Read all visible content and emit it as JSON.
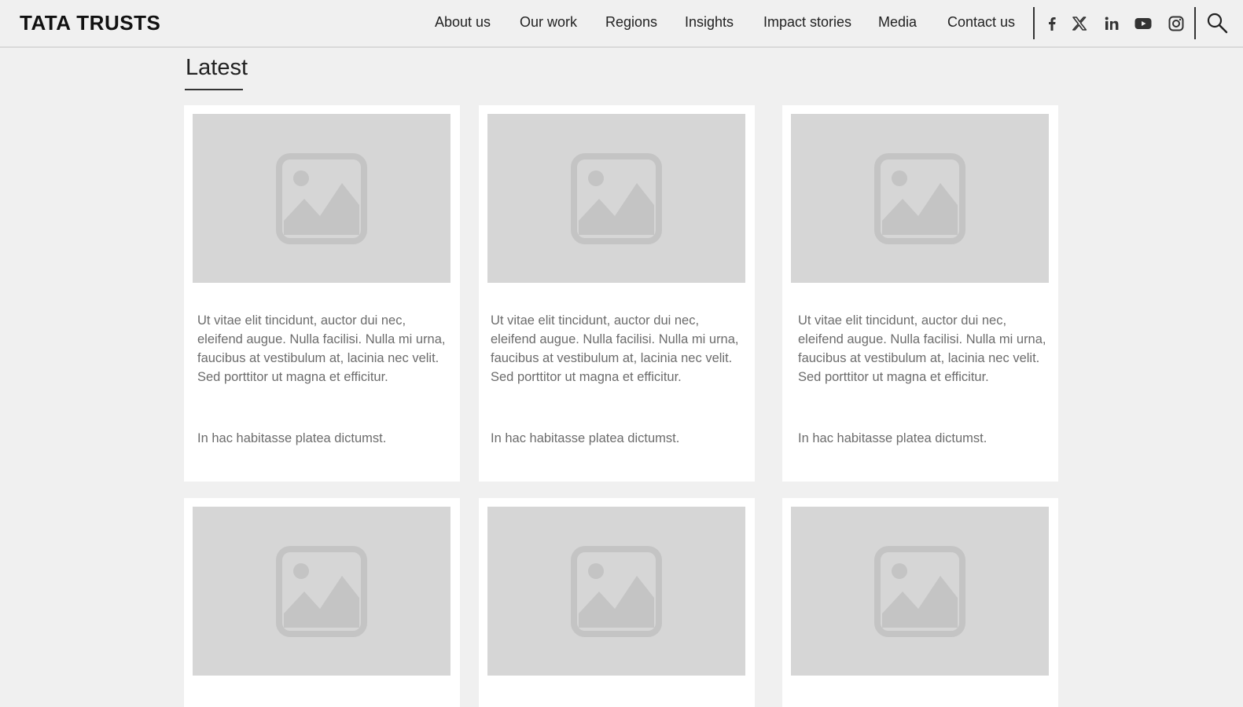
{
  "header": {
    "logo": "TATA TRUSTS",
    "nav": [
      "About us",
      "Our work",
      "Regions",
      "Insights",
      "Impact stories",
      "Media",
      "Contact us"
    ],
    "social_icons": [
      "facebook-icon",
      "x-twitter-icon",
      "linkedin-icon",
      "youtube-icon",
      "instagram-icon"
    ],
    "search_icon": "search-icon"
  },
  "main": {
    "section_title": "Latest",
    "cards": [
      {
        "image": "image-placeholder-icon",
        "description": "Ut vitae elit tincidunt, auctor dui nec, eleifend augue. Nulla facilisi. Nulla mi urna, faucibus at vestibulum at, lacinia nec velit. Sed porttitor ut magna et efficitur.",
        "meta": "In hac habitasse platea dictumst."
      },
      {
        "image": "image-placeholder-icon",
        "description": "Ut vitae elit tincidunt, auctor dui nec, eleifend augue. Nulla facilisi. Nulla mi urna, faucibus at vestibulum at, lacinia nec velit. Sed porttitor ut magna et efficitur.",
        "meta": "In hac habitasse platea dictumst."
      },
      {
        "image": "image-placeholder-icon",
        "description": "Ut vitae elit tincidunt, auctor dui nec, eleifend augue. Nulla facilisi. Nulla mi urna, faucibus at vestibulum at, lacinia nec velit. Sed porttitor ut magna et efficitur.",
        "meta": "In hac habitasse platea dictumst."
      },
      {
        "image": "image-placeholder-icon"
      },
      {
        "image": "image-placeholder-icon"
      },
      {
        "image": "image-placeholder-icon"
      }
    ]
  },
  "colors": {
    "background": "#f0f0f0",
    "card": "#ffffff",
    "placeholder": "#d6d6d6",
    "placeholder_icon": "#c4c4c4",
    "body_text": "#6c6c6c"
  }
}
